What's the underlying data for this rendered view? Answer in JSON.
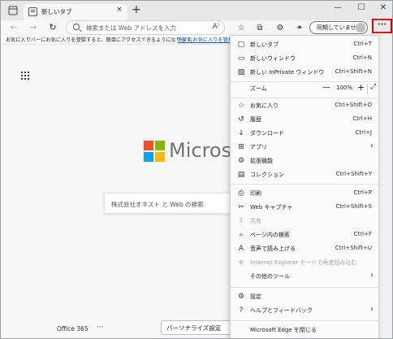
{
  "tab": {
    "title": "新しいタブ",
    "close": "×"
  },
  "window_controls": {
    "minimize": "—",
    "maximize": "☐",
    "close": "✕",
    "new_tab": "+"
  },
  "toolbar": {
    "back": "←",
    "forward": "→",
    "refresh": "↻"
  },
  "address_bar": {
    "placeholder": "検索または Web アドレスを入力",
    "read_aloud": "A⁾"
  },
  "profile": {
    "label": "同期していません"
  },
  "more_button": {
    "label": "···"
  },
  "favorites_bar": {
    "notice": "お気に入りバーにお気に入りを登録すると、簡単にアクセスできるようになります。",
    "link": "今すぐお気に入りを管理"
  },
  "page": {
    "brand_text": "Microso",
    "search_placeholder": "株式会社オネスト と Web の検索",
    "office_link": "Office 365",
    "more_dots": "···",
    "personalize": "パーソナライズ設定"
  },
  "menu": {
    "items": [
      {
        "icon": "▢",
        "label": "新しいタブ",
        "shortcut": "Ctrl+T"
      },
      {
        "icon": "▭",
        "label": "新しいウィンドウ",
        "shortcut": "Ctrl+N"
      },
      {
        "icon": "▧",
        "label": "新しい InPrivate ウィンドウ",
        "shortcut": "Ctrl+Shift+N"
      },
      {
        "icon": "",
        "label": "ズーム",
        "shortcut": ""
      },
      {
        "icon": "☆",
        "label": "お気に入り",
        "shortcut": "Ctrl+Shift+O"
      },
      {
        "icon": "↺",
        "label": "履歴",
        "shortcut": "Ctrl+H"
      },
      {
        "icon": "↓",
        "label": "ダウンロード",
        "shortcut": "Ctrl+J"
      },
      {
        "icon": "⊞",
        "label": "アプリ",
        "shortcut": "›"
      },
      {
        "icon": "⚙",
        "label": "拡張機能",
        "shortcut": ""
      },
      {
        "icon": "▤",
        "label": "コレクション",
        "shortcut": "Ctrl+Shift+Y"
      },
      {
        "icon": "⎙",
        "label": "印刷",
        "shortcut": "Ctrl+P"
      },
      {
        "icon": "✂",
        "label": "Web キャプチャ",
        "shortcut": "Ctrl+Shift+S"
      },
      {
        "icon": "⇪",
        "label": "共有",
        "shortcut": ""
      },
      {
        "icon": "⌕",
        "label": "ページ内の検索",
        "shortcut": "Ctrl+F"
      },
      {
        "icon": "A",
        "label": "音声で読み上げる",
        "shortcut": "Ctrl+Shift+U"
      },
      {
        "icon": "e",
        "label": "Internet Explorer モードで再度読み込む",
        "shortcut": ""
      },
      {
        "icon": "",
        "label": "その他のツール",
        "shortcut": "›"
      },
      {
        "icon": "⚙",
        "label": "設定",
        "shortcut": ""
      },
      {
        "icon": "?",
        "label": "ヘルプとフィードバック",
        "shortcut": "›"
      },
      {
        "icon": "",
        "label": "Microsoft Edge を閉じる",
        "shortcut": ""
      }
    ],
    "zoom": {
      "minus": "—",
      "value": "100%",
      "plus": "+",
      "fullscreen": "⤢"
    }
  },
  "colors": {
    "highlight": "#e00000",
    "ms_red": "#f25022",
    "ms_green": "#7fba00",
    "ms_blue": "#00a4ef",
    "ms_yellow": "#ffb900"
  }
}
